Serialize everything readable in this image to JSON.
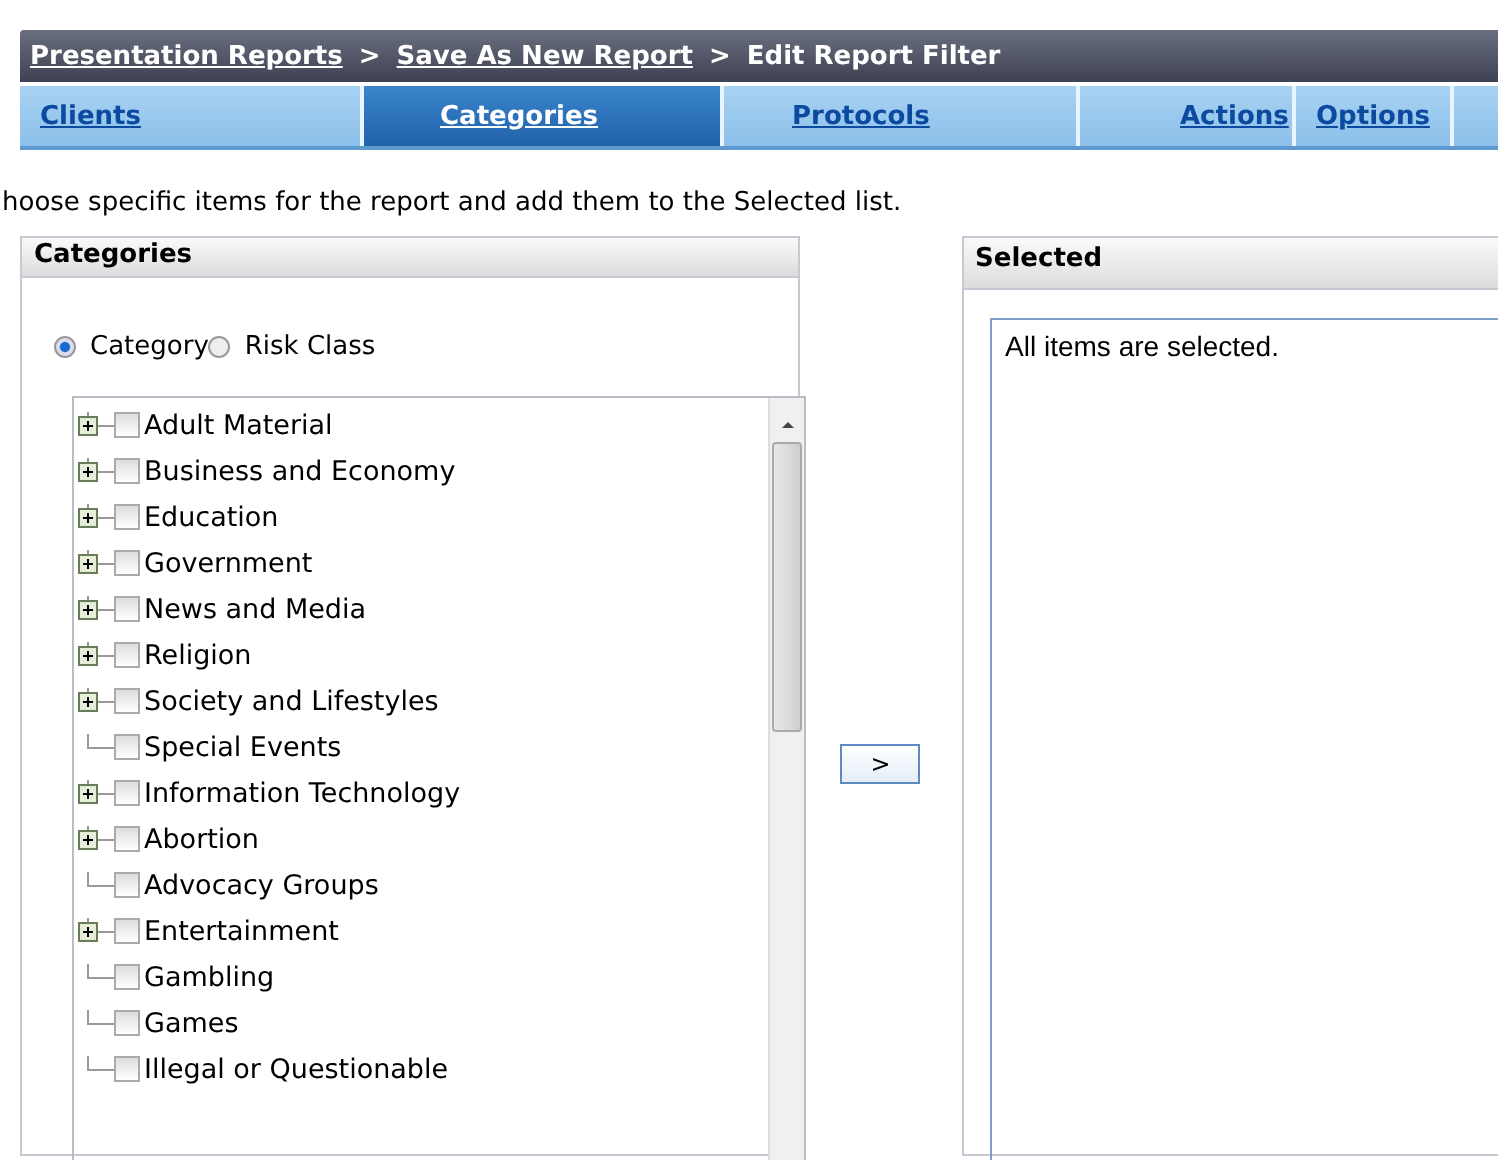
{
  "breadcrumb": [
    {
      "label": "Presentation Reports",
      "link": true
    },
    {
      "label": "Save As New Report",
      "link": true
    },
    {
      "label": "Edit Report Filter",
      "link": false
    }
  ],
  "breadcrumb_separator": ">",
  "tabs": [
    {
      "label": "Clients",
      "selected": false
    },
    {
      "label": "Categories",
      "selected": true
    },
    {
      "label": "Protocols",
      "selected": false
    },
    {
      "label": "Actions",
      "selected": false
    },
    {
      "label": "Options",
      "selected": false
    }
  ],
  "instruction": "hoose specific items for the report and add them to the Selected list.",
  "categories_panel": {
    "title": "Categories",
    "view_options": [
      {
        "label": "Category",
        "selected": true
      },
      {
        "label": "Risk Class",
        "selected": false
      }
    ],
    "tree": [
      {
        "label": "Adult Material",
        "expandable": true,
        "checked": false
      },
      {
        "label": "Business and Economy",
        "expandable": true,
        "checked": false
      },
      {
        "label": "Education",
        "expandable": true,
        "checked": false
      },
      {
        "label": "Government",
        "expandable": true,
        "checked": false
      },
      {
        "label": "News and Media",
        "expandable": true,
        "checked": false
      },
      {
        "label": "Religion",
        "expandable": true,
        "checked": false
      },
      {
        "label": "Society and Lifestyles",
        "expandable": true,
        "checked": false
      },
      {
        "label": "Special Events",
        "expandable": false,
        "checked": false
      },
      {
        "label": "Information Technology",
        "expandable": true,
        "checked": false
      },
      {
        "label": "Abortion",
        "expandable": true,
        "checked": false
      },
      {
        "label": "Advocacy Groups",
        "expandable": false,
        "checked": false
      },
      {
        "label": "Entertainment",
        "expandable": true,
        "checked": false
      },
      {
        "label": "Gambling",
        "expandable": false,
        "checked": false
      },
      {
        "label": "Games",
        "expandable": false,
        "checked": false
      },
      {
        "label": "Illegal or Questionable",
        "expandable": false,
        "checked": false
      }
    ]
  },
  "add_button": ">",
  "selected_panel": {
    "title": "Selected",
    "message": "All items are selected."
  }
}
